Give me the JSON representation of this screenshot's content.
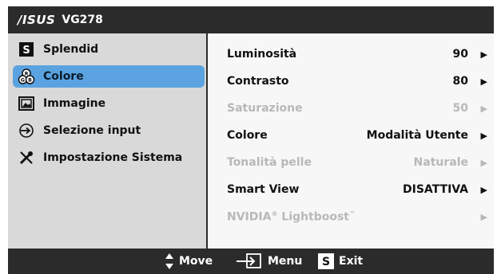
{
  "title": {
    "brand": "/ISUS",
    "model": "VG278"
  },
  "left_menu": [
    {
      "label": "Splendid",
      "icon": "splendid-s-icon"
    },
    {
      "label": "Colore",
      "icon": "color-palette-icon",
      "selected": true
    },
    {
      "label": "Immagine",
      "icon": "image-icon"
    },
    {
      "label": "Selezione input",
      "icon": "input-select-icon"
    },
    {
      "label": "Impostazione Sistema",
      "icon": "tools-icon"
    }
  ],
  "settings": [
    {
      "label": "Luminosità",
      "value": "90",
      "enabled": true
    },
    {
      "label": "Contrasto",
      "value": "80",
      "enabled": true
    },
    {
      "label": "Saturazione",
      "value": "50",
      "enabled": false
    },
    {
      "label": "Colore",
      "value": "Modalità Utente",
      "enabled": true
    },
    {
      "label": "Tonalità pelle",
      "value": "Naturale",
      "enabled": false
    },
    {
      "label": "Smart View",
      "value": "DISATTIVA",
      "enabled": true
    },
    {
      "label_main": "NVIDIA",
      "label_reg": "®",
      "label_sub": " Lightboost",
      "label_tm": "™",
      "value": "",
      "enabled": false
    }
  ],
  "footer": {
    "move": "Move",
    "menu": "Menu",
    "exit": "Exit",
    "exit_key": "S"
  },
  "colors": {
    "bar": "#2b2b2b",
    "selected": "#5aa3e0",
    "disabled_text": "#b8b8b8"
  }
}
